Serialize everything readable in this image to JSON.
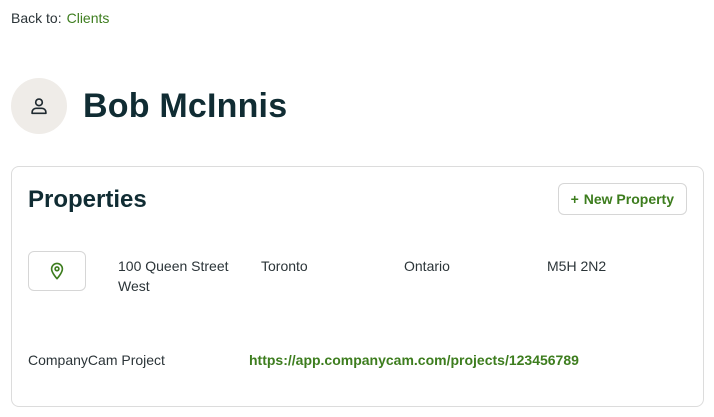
{
  "breadcrumb": {
    "prefix": "Back to:",
    "link_label": "Clients"
  },
  "client": {
    "name": "Bob McInnis",
    "avatar_icon": "user-icon"
  },
  "properties": {
    "title": "Properties",
    "new_button_plus": "+",
    "new_button_label": "New Property",
    "map_icon": "map-pin-icon",
    "items": [
      {
        "street": "100 Queen Street West",
        "city": "Toronto",
        "province": "Ontario",
        "postal_code": "M5H 2N2"
      }
    ],
    "companycam": {
      "label": "CompanyCam Project",
      "url": "https://app.companycam.com/projects/123456789"
    }
  },
  "colors": {
    "accent": "#3d7d1e",
    "heading": "#102c33",
    "avatar_bg": "#efece8",
    "border": "#dcdcdc"
  }
}
